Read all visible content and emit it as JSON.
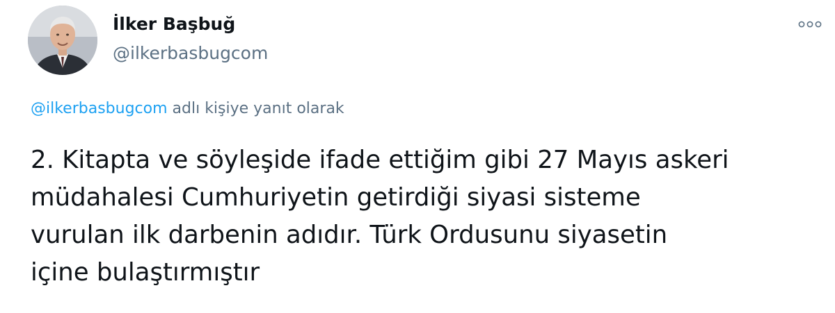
{
  "tweet": {
    "author": {
      "display_name": "İlker Başbuğ",
      "handle": "@ilkerbasbugcom"
    },
    "more_icon": "more-horizontal-icon",
    "reply_context": {
      "mention": "@ilkerbasbugcom",
      "suffix": " adlı kişiye yanıt olarak"
    },
    "text": "2. Kitapta ve söyleşide ifade ettiğim gibi 27 Mayıs askeri\nmüdahalesi Cumhuriyetin getirdiği siyasi sisteme\nvurulan ilk darbenin adıdır.  Türk Ordusunu siyasetin\niçine bulaştırmıştır",
    "colors": {
      "link": "#1da1f2",
      "secondary_text": "#5b7083",
      "primary_text": "#0f1419"
    }
  }
}
